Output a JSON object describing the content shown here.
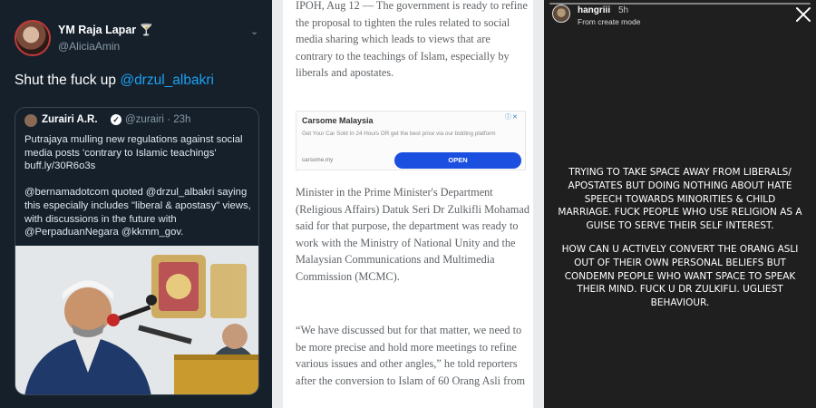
{
  "tweet": {
    "author_name": "YM Raja Lapar 🍸",
    "author_handle": "@AliciaAmin",
    "text_prefix": "Shut the fuck up ",
    "text_mention": "@drzul_albakri",
    "quote": {
      "author_name": "Zurairi A.R.",
      "verified_mark": "✓",
      "meta": "@zurairi · 23h",
      "paragraph1": "Putrajaya mulling new regulations against social media posts 'contrary to Islamic teachings' buff.ly/30R6o3s",
      "paragraph2": "@bernamadotcom quoted @drzul_albakri saying this especially includes \"liberal & apostasy\" views, with discussions in the future with @PerpaduanNegara @kkmm_gov."
    }
  },
  "article": {
    "paragraph1": "IPOH, Aug 12 — The government is ready to refine the proposal to tighten the rules related to social media sharing which leads to views that are contrary to the teachings of Islam, especially by liberals and apostates.",
    "ad": {
      "title": "Carsome Malaysia",
      "description": "Get Your Car Sold In 24 Hours OR get the best price via our bidding platform",
      "url": "carsome.my",
      "button_label": "OPEN",
      "badge": "ⓘ✕"
    },
    "paragraph2": "Minister in the Prime Minister's Department (Religious Affairs) Datuk Seri Dr Zulkifli Mohamad said for that purpose, the department was ready to work with the Ministry of National Unity and the Malaysian Communications and Multimedia Commission (MCMC).",
    "paragraph3": "“We have discussed but for that matter, we need to be more precise and hold more meetings to refine various issues and other angles,” he told reporters after the conversion to Islam of 60 Orang Asli from"
  },
  "story": {
    "username": "hangriii",
    "time": "5h",
    "subtitle": "From create mode",
    "paragraph1": "TRYING TO TAKE SPACE AWAY FROM LIBERALS/ APOSTATES BUT DOING NOTHING ABOUT HATE SPEECH TOWARDS MINORITIES & CHILD MARRIAGE. FUCK PEOPLE WHO USE RELIGION AS A GUISE TO SERVE THEIR SELF INTEREST.",
    "paragraph2": "HOW CAN U ACTIVELY CONVERT THE ORANG ASLI OUT OF THEIR OWN PERSONAL BELIEFS BUT CONDEMN PEOPLE WHO WANT SPACE TO SPEAK THEIR MIND. FUCK U DR ZULKIFLI. UGLIEST BEHAVIOUR."
  }
}
